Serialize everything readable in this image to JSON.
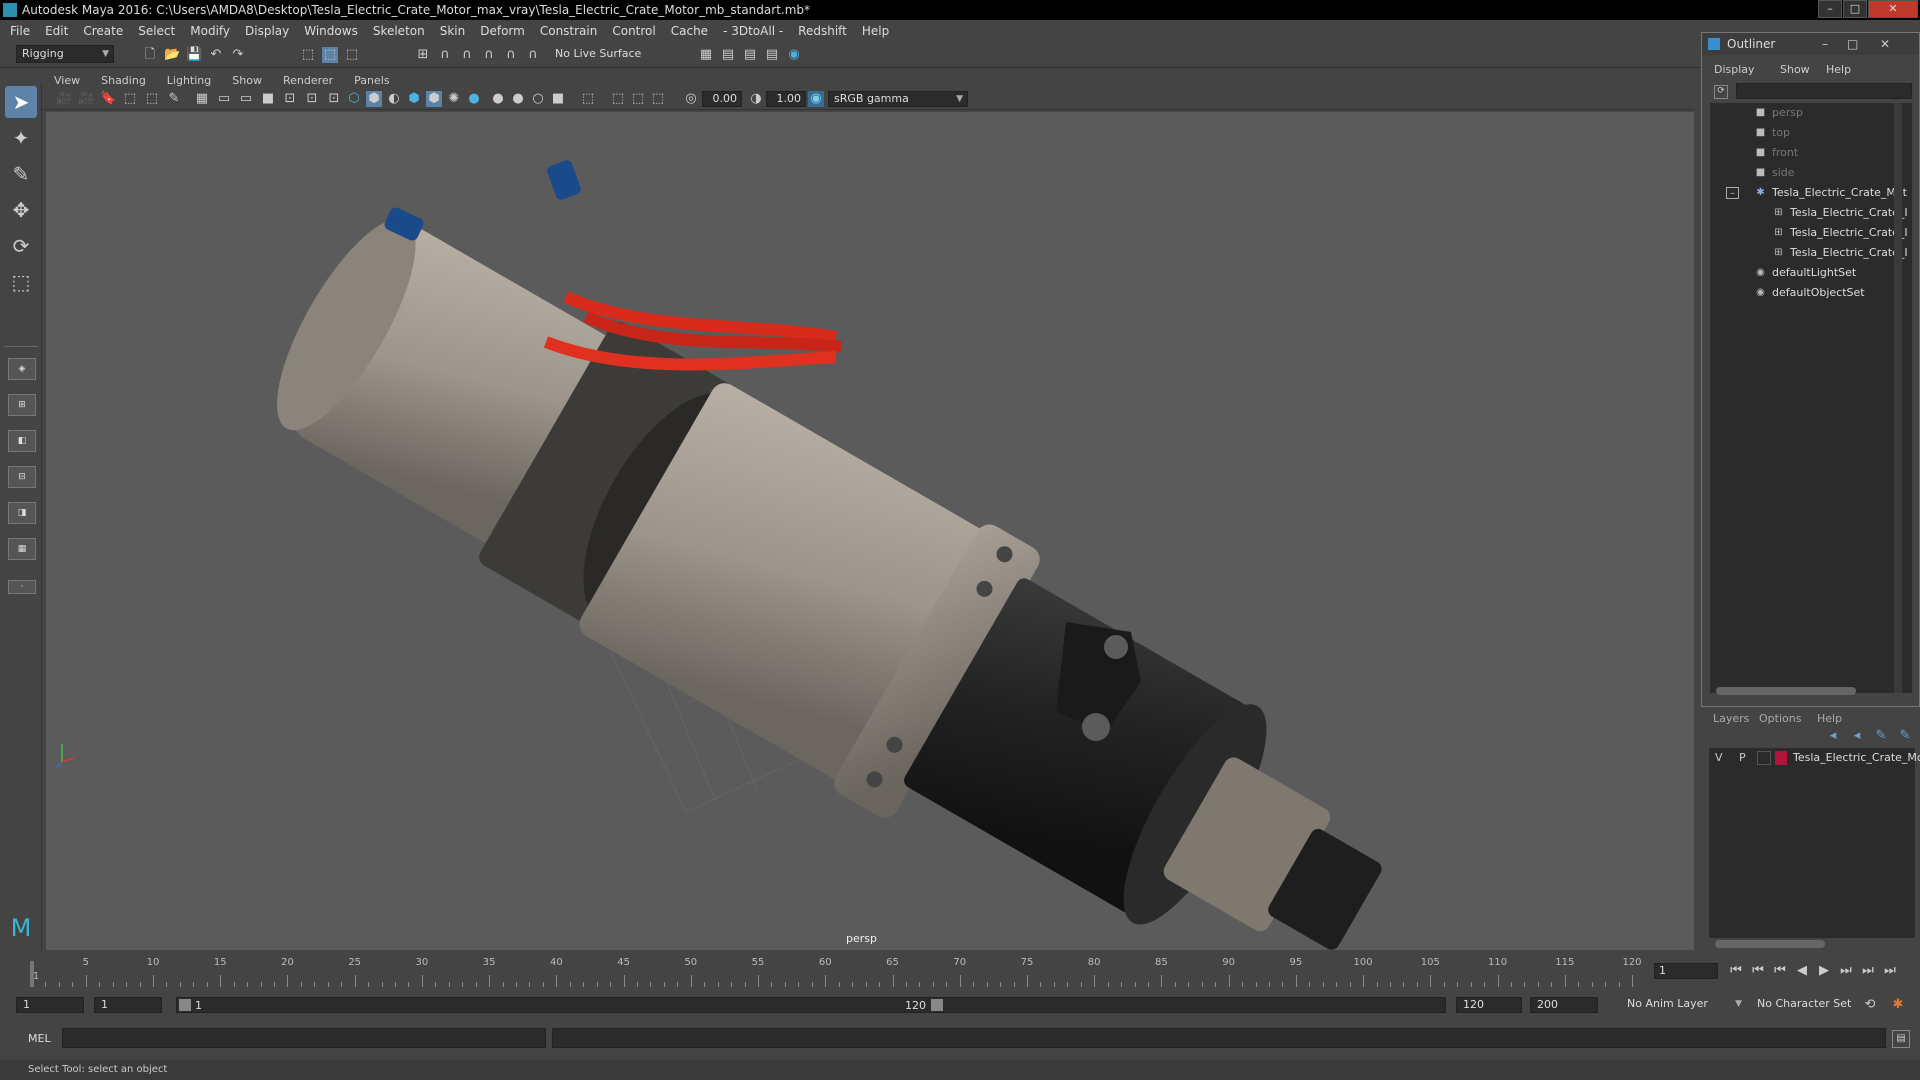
{
  "window": {
    "title": "Autodesk Maya 2016: C:\\Users\\AMDA8\\Desktop\\Tesla_Electric_Crate_Motor_max_vray\\Tesla_Electric_Crate_Motor_mb_standart.mb*"
  },
  "menus": [
    "File",
    "Edit",
    "Create",
    "Select",
    "Modify",
    "Display",
    "Windows",
    "Skeleton",
    "Skin",
    "Deform",
    "Constrain",
    "Control",
    "Cache",
    "- 3DtoAll -",
    "Redshift",
    "Help"
  ],
  "shelf": {
    "mode": "Rigging",
    "live_surface": "No Live Surface"
  },
  "panel": {
    "menus": [
      "View",
      "Shading",
      "Lighting",
      "Show",
      "Renderer",
      "Panels"
    ],
    "exposure": "0.00",
    "gamma": "1.00",
    "color_space": "sRGB gamma",
    "camera_label": "persp"
  },
  "outliner": {
    "title": "Outliner",
    "menus": [
      "Display",
      "Show",
      "Help"
    ],
    "items": [
      {
        "label": "persp",
        "kind": "camera"
      },
      {
        "label": "top",
        "kind": "camera"
      },
      {
        "label": "front",
        "kind": "camera"
      },
      {
        "label": "side",
        "kind": "camera"
      },
      {
        "label": "Tesla_Electric_Crate_Mot",
        "kind": "group"
      },
      {
        "label": "Tesla_Electric_Crate_I",
        "kind": "mesh"
      },
      {
        "label": "Tesla_Electric_Crate_I",
        "kind": "mesh"
      },
      {
        "label": "Tesla_Electric_Crate_I",
        "kind": "mesh"
      },
      {
        "label": "defaultLightSet",
        "kind": "set"
      },
      {
        "label": "defaultObjectSet",
        "kind": "set"
      }
    ]
  },
  "layers": {
    "menus": [
      "Layers",
      "Options",
      "Help"
    ],
    "row": {
      "v": "V",
      "p": "P",
      "name": "Tesla_Electric_Crate_Mc",
      "color": "#b3143c"
    }
  },
  "timeline": {
    "ticks": [
      "1",
      "5",
      "10",
      "15",
      "20",
      "25",
      "30",
      "35",
      "40",
      "45",
      "50",
      "55",
      "60",
      "65",
      "70",
      "75",
      "80",
      "85",
      "90",
      "95",
      "100",
      "105",
      "110",
      "115",
      "120"
    ],
    "current_frame": "1"
  },
  "range": {
    "start": "1",
    "playback_start": "1",
    "slider_start": "1",
    "slider_end": "120",
    "playback_end": "120",
    "end": "200",
    "anim_layer": "No Anim Layer",
    "character_set": "No Character Set"
  },
  "cmd": {
    "lang": "MEL"
  },
  "status": {
    "message": "Select Tool: select an object"
  }
}
